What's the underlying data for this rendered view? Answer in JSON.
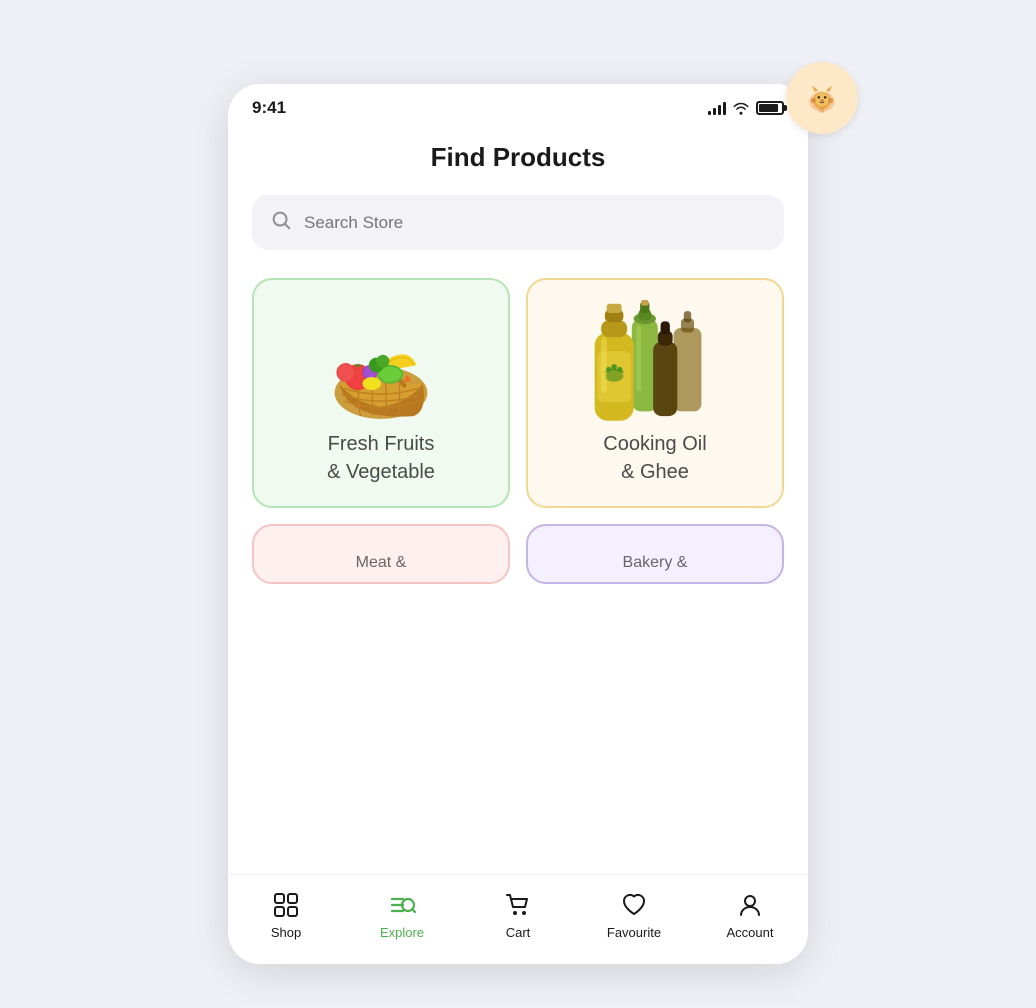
{
  "status_bar": {
    "time": "9:41"
  },
  "page": {
    "title": "Find Products"
  },
  "search": {
    "placeholder": "Search Store"
  },
  "categories": [
    {
      "id": "fresh",
      "label": "Fresh Fruits\n& Vegetable",
      "theme": "fresh"
    },
    {
      "id": "oil",
      "label": "Cooking Oil\n& Ghee",
      "theme": "oil"
    }
  ],
  "partial_categories": [
    {
      "id": "meat",
      "label": "Meat &",
      "theme": "meat"
    },
    {
      "id": "bakery",
      "label": "Bakery &",
      "theme": "bakery"
    }
  ],
  "nav": {
    "items": [
      {
        "id": "shop",
        "label": "Shop",
        "active": false
      },
      {
        "id": "explore",
        "label": "Explore",
        "active": true
      },
      {
        "id": "cart",
        "label": "Cart",
        "active": false
      },
      {
        "id": "favourite",
        "label": "Favourite",
        "active": false
      },
      {
        "id": "account",
        "label": "Account",
        "active": false
      }
    ]
  },
  "colors": {
    "active_nav": "#4caf50",
    "inactive_nav": "#1a1a1a",
    "fresh_bg": "#f0faf0",
    "fresh_border": "#b5e5b5",
    "oil_bg": "#fef9ee",
    "oil_border": "#f0d890",
    "meat_bg": "#fff0f0",
    "bakery_bg": "#f5f0ff",
    "lion_bg": "#fde8c8",
    "lion_color": "#e07b2a"
  }
}
